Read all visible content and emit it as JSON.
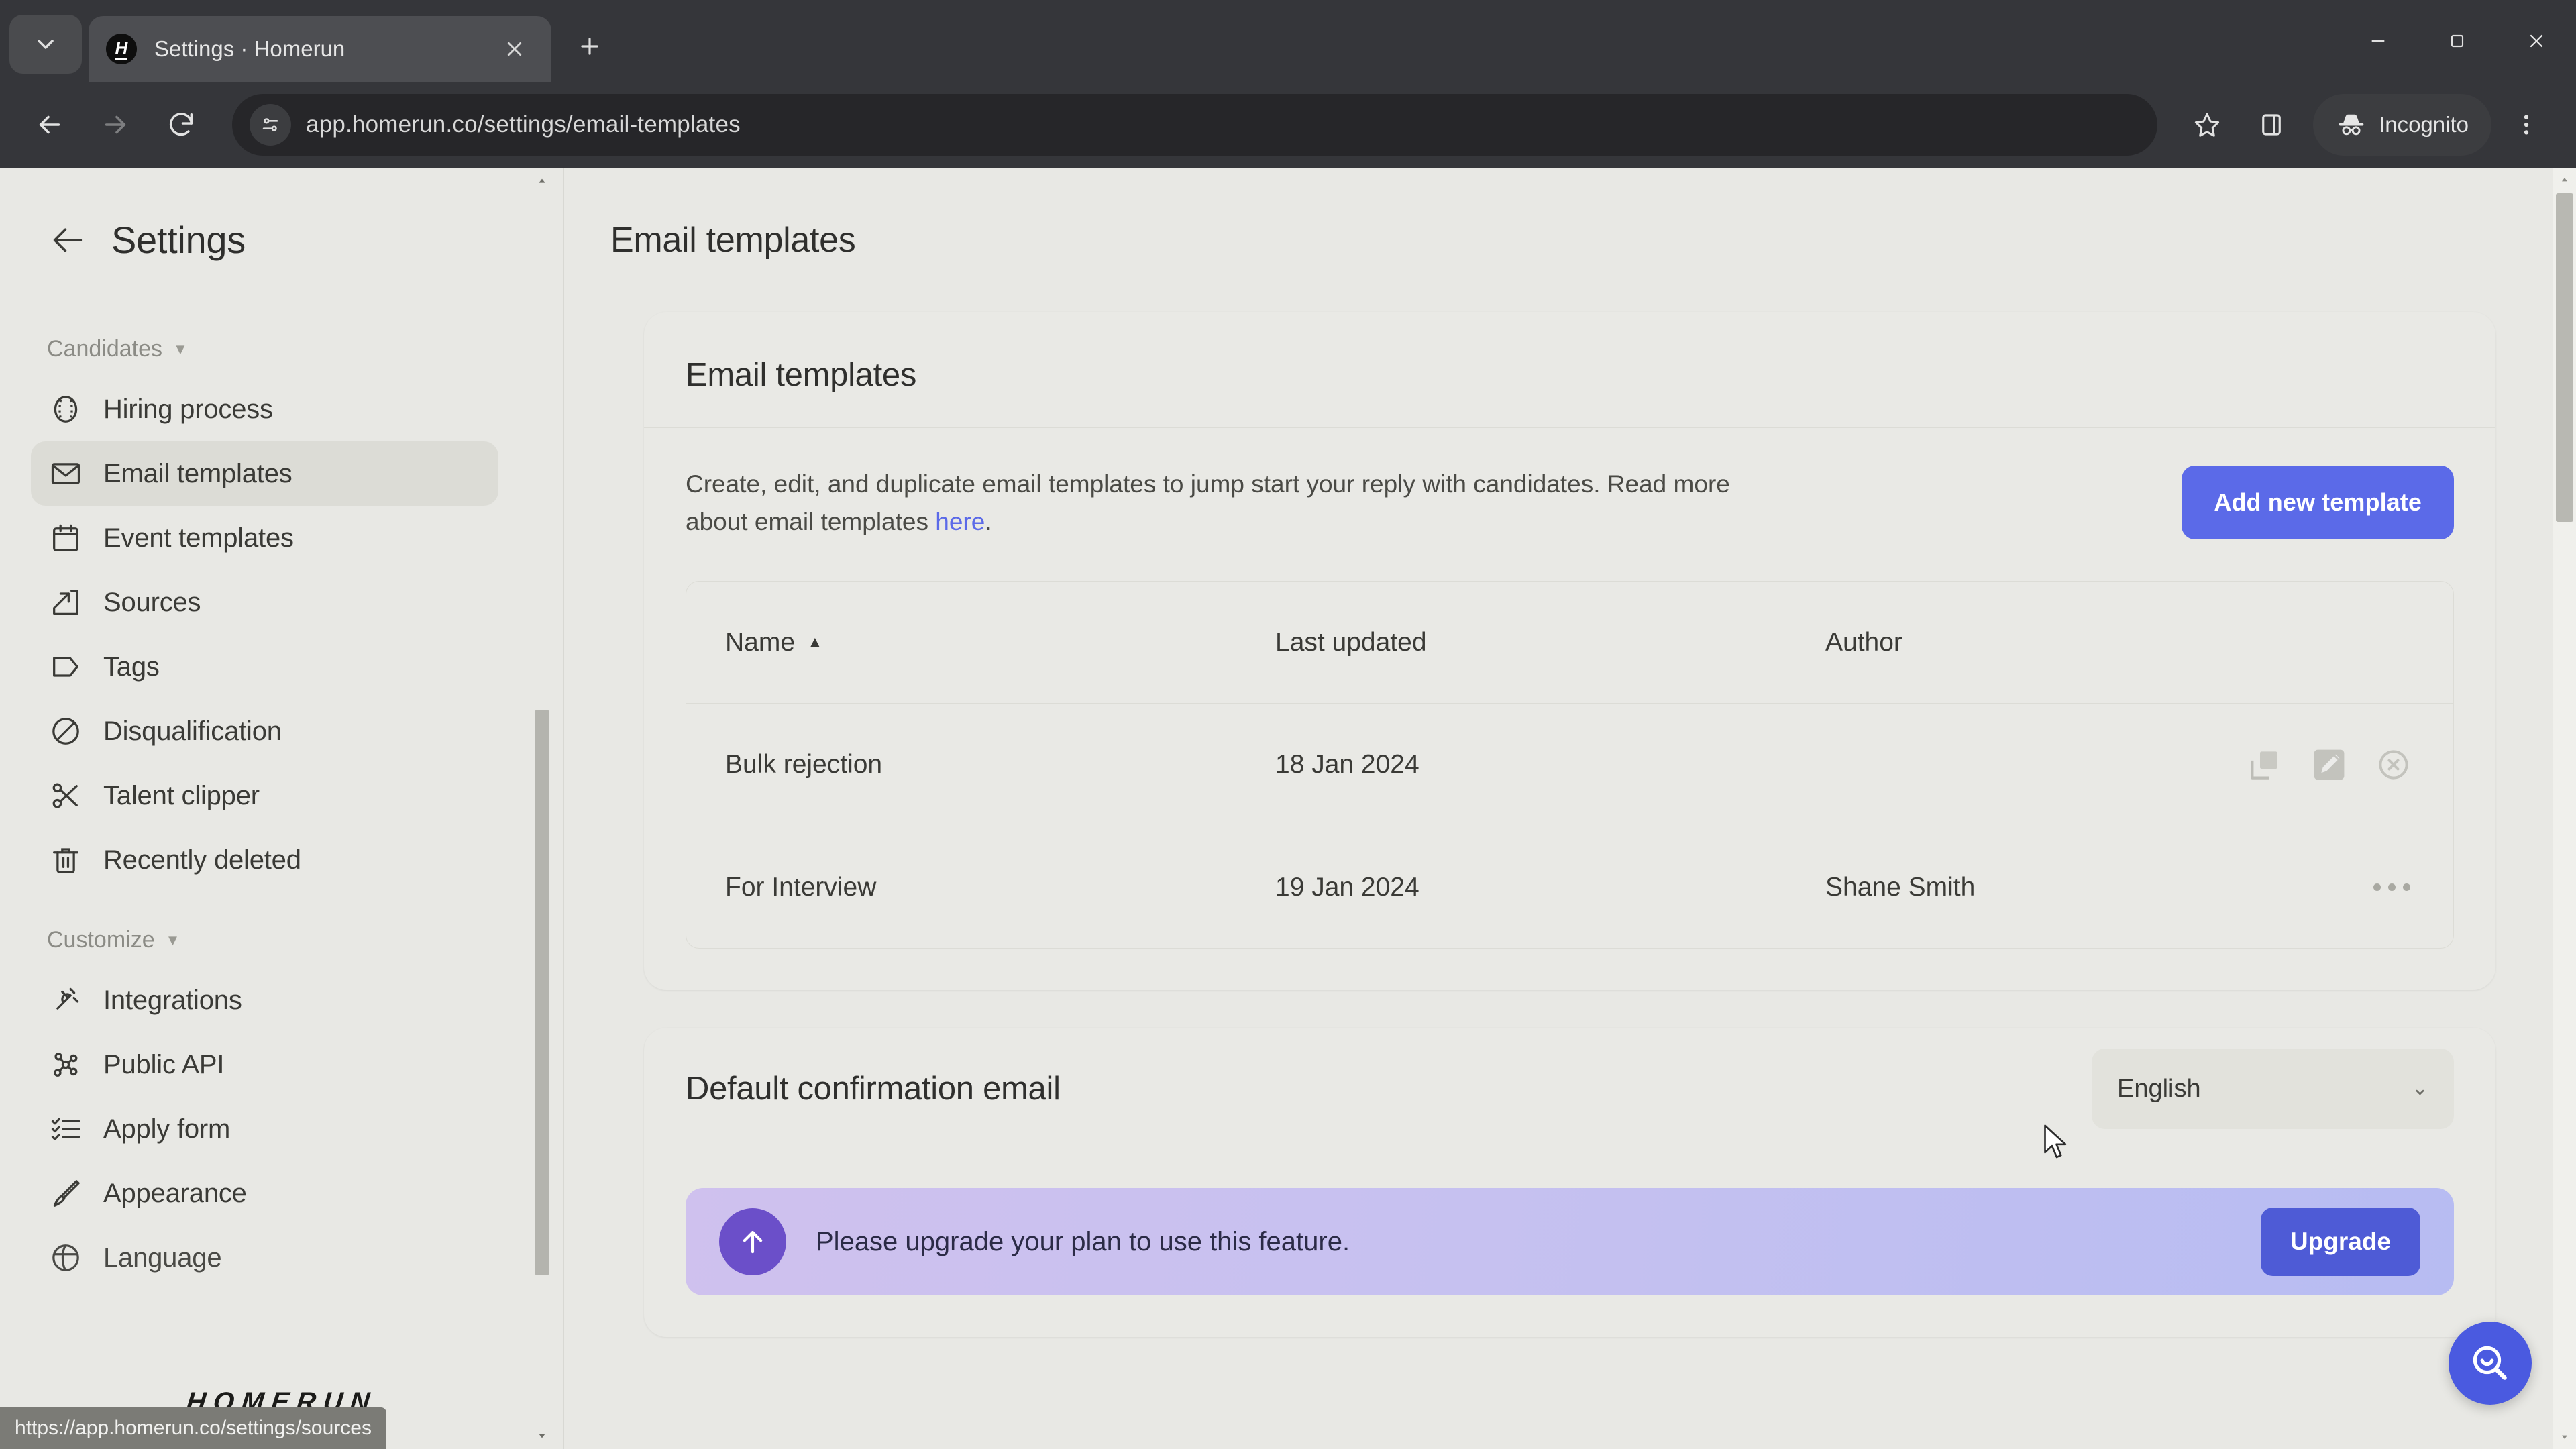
{
  "browser": {
    "tab": {
      "title": "Settings · Homerun",
      "favicon_letter": "H"
    },
    "new_tab_tooltip": "New Tab",
    "omnibox": {
      "url": "app.homerun.co/settings/email-templates"
    },
    "profile_badge": "Incognito",
    "status_link": "https://app.homerun.co/settings/sources"
  },
  "sidebar": {
    "title": "Settings",
    "logo": "HOMERUN",
    "groups": [
      {
        "label": "Candidates",
        "items": [
          {
            "label": "Hiring process",
            "icon": "hiring-process-icon",
            "active": false
          },
          {
            "label": "Email templates",
            "icon": "envelope-icon",
            "active": true
          },
          {
            "label": "Event templates",
            "icon": "calendar-icon",
            "active": false
          },
          {
            "label": "Sources",
            "icon": "sources-icon",
            "active": false
          },
          {
            "label": "Tags",
            "icon": "tag-icon",
            "active": false
          },
          {
            "label": "Disqualification",
            "icon": "no-entry-icon",
            "active": false
          },
          {
            "label": "Talent clipper",
            "icon": "scissors-icon",
            "active": false
          },
          {
            "label": "Recently deleted",
            "icon": "trash-icon",
            "active": false
          }
        ]
      },
      {
        "label": "Customize",
        "items": [
          {
            "label": "Integrations",
            "icon": "plug-icon",
            "active": false
          },
          {
            "label": "Public API",
            "icon": "network-icon",
            "active": false
          },
          {
            "label": "Apply form",
            "icon": "checklist-icon",
            "active": false
          },
          {
            "label": "Appearance",
            "icon": "paintbrush-icon",
            "active": false
          },
          {
            "label": "Language",
            "icon": "globe-icon",
            "active": false
          }
        ]
      }
    ]
  },
  "main": {
    "page_title": "Email templates",
    "templates_card": {
      "heading": "Email templates",
      "description_before": "Create, edit, and duplicate email templates to jump start your reply with candidates. Read more about email templates ",
      "description_link": "here",
      "description_after": ".",
      "add_button": "Add new template",
      "columns": [
        "Name",
        "Last updated",
        "Author"
      ],
      "sort_column": "Name",
      "sort_direction": "▲",
      "rows": [
        {
          "name": "Bulk rejection",
          "last_updated": "18 Jan 2024",
          "author": "",
          "hovered": true
        },
        {
          "name": "For Interview",
          "last_updated": "19 Jan 2024",
          "author": "Shane Smith",
          "hovered": false
        }
      ],
      "row_actions": [
        "duplicate-icon",
        "edit-icon",
        "delete-icon"
      ]
    },
    "confirmation_card": {
      "heading": "Default confirmation email",
      "language_value": "English",
      "upgrade_message": "Please upgrade your plan to use this feature.",
      "upgrade_button": "Upgrade"
    }
  },
  "colors": {
    "accent_blue": "#5b6ae8",
    "page_bg": "#e8e8e4",
    "chrome_bg": "#35363a",
    "upgrade_button": "#4e5bd6"
  }
}
